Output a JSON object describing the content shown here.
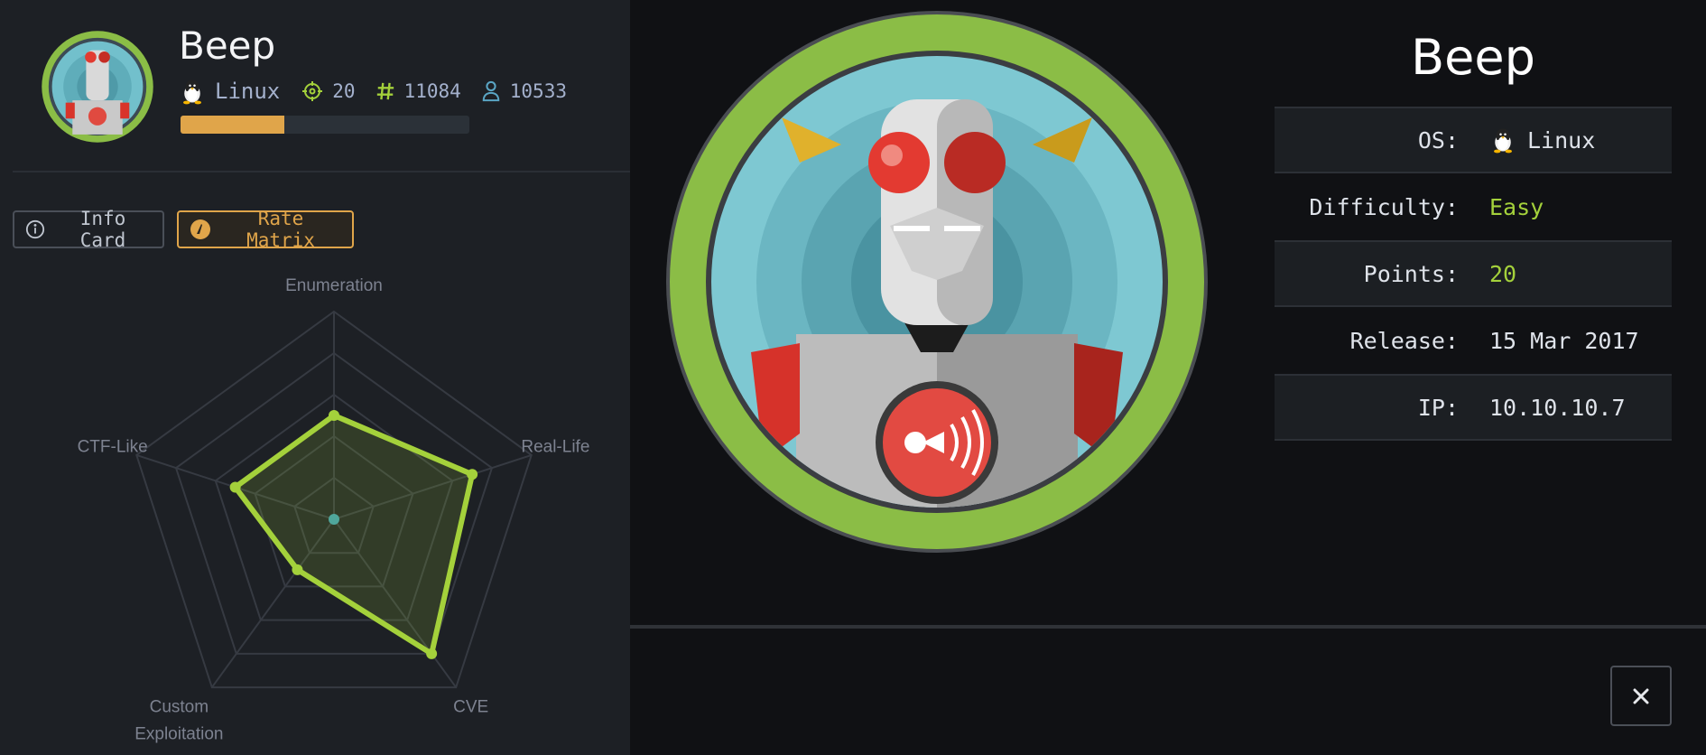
{
  "machine": {
    "name": "Beep",
    "os": "Linux",
    "points": "20",
    "user_owns": "11084",
    "system_owns": "10533",
    "progress_fraction": 0.36
  },
  "buttons": {
    "info_card": "Info Card",
    "rate_matrix": "Rate Matrix",
    "close_glyph": "✕"
  },
  "icons": {
    "os": "linux-tux-icon",
    "points": "crosshair-icon",
    "user_owns": "hash-icon",
    "system_owns": "user-icon",
    "info": "info-circle-icon",
    "rate": "gauge-icon",
    "close": "close-icon"
  },
  "colors": {
    "accent_green": "#a4d13b",
    "accent_orange": "#e0a54a",
    "user_blue": "#5aa5c4"
  },
  "card": {
    "title": "Beep",
    "rows": [
      {
        "label": "OS:",
        "value": "Linux"
      },
      {
        "label": "Difficulty:",
        "value": "Easy"
      },
      {
        "label": "Points:",
        "value": "20"
      },
      {
        "label": "Release:",
        "value": "15 Mar 2017"
      },
      {
        "label": "IP:",
        "value": "10.10.10.7"
      }
    ]
  },
  "chart_data": {
    "type": "radar",
    "axes": [
      "Enumeration",
      "Real-Life",
      "CVE",
      "Custom Exploitation",
      "CTF-Like"
    ],
    "values": [
      5,
      7,
      8,
      3,
      5
    ],
    "max": 10,
    "rings": 5
  }
}
